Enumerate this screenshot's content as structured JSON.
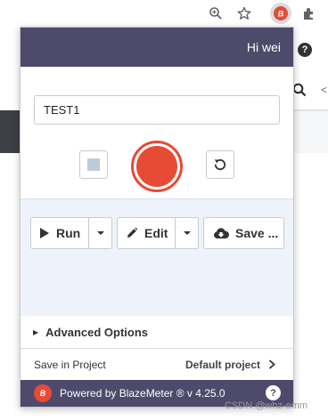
{
  "header": {
    "greeting": "Hi wei"
  },
  "test_name": {
    "value": "TEST1",
    "placeholder": ""
  },
  "actions": {
    "run_label": "Run",
    "edit_label": "Edit",
    "save_label": "Save ..."
  },
  "advanced": {
    "label": "Advanced Options"
  },
  "project": {
    "label": "Save in Project",
    "value": "Default project"
  },
  "footer": {
    "powered_by": "Powered by BlazeMeter ® v 4.25.0",
    "logo_text": "B",
    "help_label": "?"
  },
  "background": {
    "help_label": "?"
  },
  "watermark": "CSDN @whz-emm",
  "colors": {
    "brand": "#4d4a6b",
    "record": "#e74a35",
    "panel": "#eef3fb"
  },
  "icons": [
    "zoom-icon",
    "star-icon",
    "blazemeter-extension-icon",
    "puzzle-icon",
    "stop-icon",
    "record-icon",
    "reset-icon",
    "play-icon",
    "pencil-icon",
    "caret-down-icon",
    "cloud-download-icon",
    "triangle-right-icon",
    "chevron-right-icon",
    "help-icon",
    "search-icon"
  ]
}
